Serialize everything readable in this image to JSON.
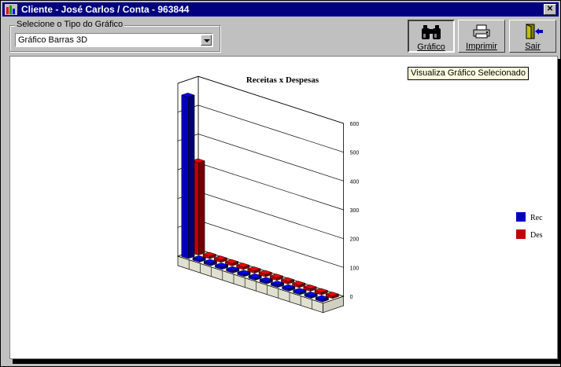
{
  "window": {
    "title": "Cliente - José Carlos / Conta - 963844",
    "close_glyph": "✕"
  },
  "chart_type_group": {
    "legend": "Selecione o Tipo do Gráfico",
    "selected": "Gráfico Barras 3D"
  },
  "toolbar": {
    "grafico_label": "Gráfico",
    "imprimir_label": "Imprimir",
    "sair_label": "Sair",
    "tooltip": "Visualiza Gráfico Selecionado"
  },
  "icons": {
    "grafico": "binoculars-icon",
    "imprimir": "printer-icon",
    "sair": "exit-door-icon"
  },
  "colors": {
    "title_bar": "#000080",
    "rec": "#0000c0",
    "des": "#c00000",
    "tooltip_bg": "#ffffe1"
  },
  "chart_data": {
    "type": "bar",
    "subtype": "3d-clustered",
    "title": "Receitas x Despesas",
    "series": [
      {
        "name": "Rec",
        "color": "#0000c0",
        "values": [
          560,
          8,
          8,
          8,
          8,
          8,
          8,
          8,
          8,
          8,
          8,
          8,
          8
        ]
      },
      {
        "name": "Des",
        "color": "#c00000",
        "values": [
          320,
          8,
          8,
          8,
          8,
          8,
          8,
          8,
          8,
          8,
          8,
          8,
          8
        ]
      }
    ],
    "ylim": [
      0,
      600
    ],
    "yticks": [
      0,
      100,
      200,
      300,
      400,
      500,
      600
    ],
    "ytick_labels": [
      "0",
      "100",
      "200",
      "300",
      "400",
      "500",
      "600"
    ],
    "grid": true,
    "legend_position": "right"
  }
}
